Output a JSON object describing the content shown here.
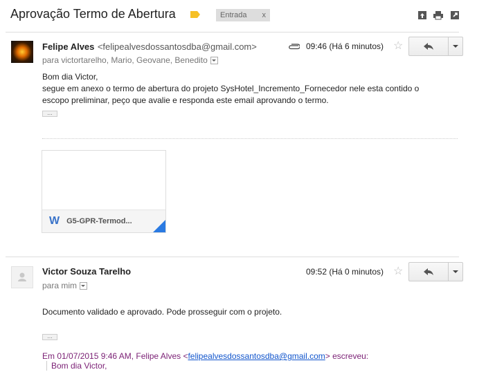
{
  "thread": {
    "subject": "Aprovação Termo de Abertura",
    "label": "Entrada",
    "label_close": "x"
  },
  "header_icons": [
    "archive-icon",
    "print-icon",
    "new-window-icon"
  ],
  "messages": [
    {
      "sender_name": "Felipe Alves",
      "sender_email": "<felipealvesdossantosdba@gmail.com>",
      "recipients": "para victortarelho, Mario, Geovane, Benedito",
      "time": "09:46 (Há 6 minutos)",
      "body": [
        "Bom dia  Victor,",
        "segue em anexo o termo de abertura do projeto SysHotel_Incremento_Fornecedor nele esta contido o",
        "escopo preliminar, peço que avalie e responda este email aprovando o termo."
      ],
      "ellipsis": "...",
      "attachment": {
        "icon": "W",
        "name": "G5-GPR-Termod..."
      }
    },
    {
      "sender_name": "Victor Souza Tarelho",
      "recipients": "para mim",
      "time": "09:52 (Há 0 minutos)",
      "body": [
        "Documento validado e aprovado. Pode prosseguir com o projeto."
      ],
      "ellipsis": "...",
      "quote_prefix": "Em 01/07/2015 9:46 AM, Felipe Alves <",
      "quote_email": "felipealvesdossantosdba@gmail.com",
      "quote_suffix": "> escreveu:",
      "quote_line": "Bom dia  Victor,"
    }
  ],
  "colors": {
    "accent_blue": "#2a7ae2",
    "label_yellow": "#f6c026",
    "quote_purple": "#7a1f74",
    "link": "#1155cc"
  }
}
